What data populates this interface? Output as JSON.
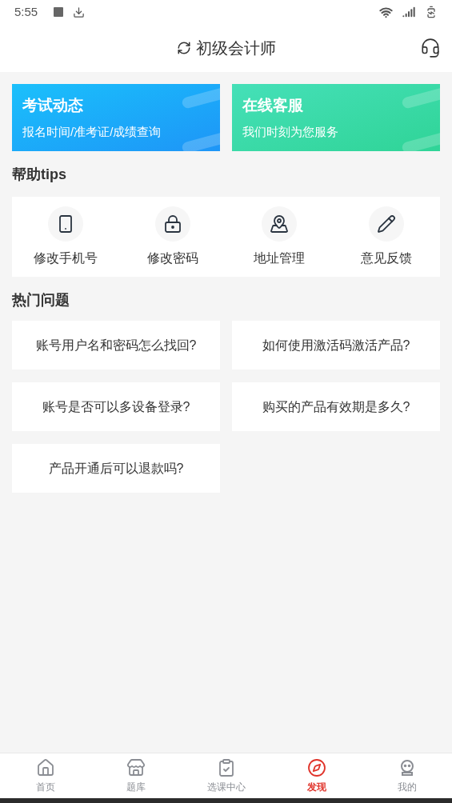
{
  "status_bar": {
    "time": "5:55"
  },
  "header": {
    "title": "初级会计师"
  },
  "banners": [
    {
      "kind": "blue",
      "title": "考试动态",
      "subtitle": "报名时间/准考证/成绩查询"
    },
    {
      "kind": "green",
      "title": "在线客服",
      "subtitle": "我们时刻为您服务"
    }
  ],
  "tips": {
    "heading": "帮助tips",
    "items": [
      {
        "kind": "phone",
        "label": "修改手机号"
      },
      {
        "kind": "lock",
        "label": "修改密码"
      },
      {
        "kind": "map",
        "label": "地址管理"
      },
      {
        "kind": "pencil",
        "label": "意见反馈"
      }
    ]
  },
  "faq": {
    "heading": "热门问题",
    "items": [
      "账号用户名和密码怎么找回?",
      "如何使用激活码激活产品?",
      "账号是否可以多设备登录?",
      "购买的产品有效期是多久?",
      "产品开通后可以退款吗?"
    ]
  },
  "nav": [
    {
      "kind": "home",
      "label": "首页",
      "selected": false
    },
    {
      "kind": "store",
      "label": "题库",
      "selected": false
    },
    {
      "kind": "clipboard",
      "label": "选课中心",
      "selected": false
    },
    {
      "kind": "compass",
      "label": "发现",
      "selected": true
    },
    {
      "kind": "robot",
      "label": "我的",
      "selected": false
    }
  ]
}
